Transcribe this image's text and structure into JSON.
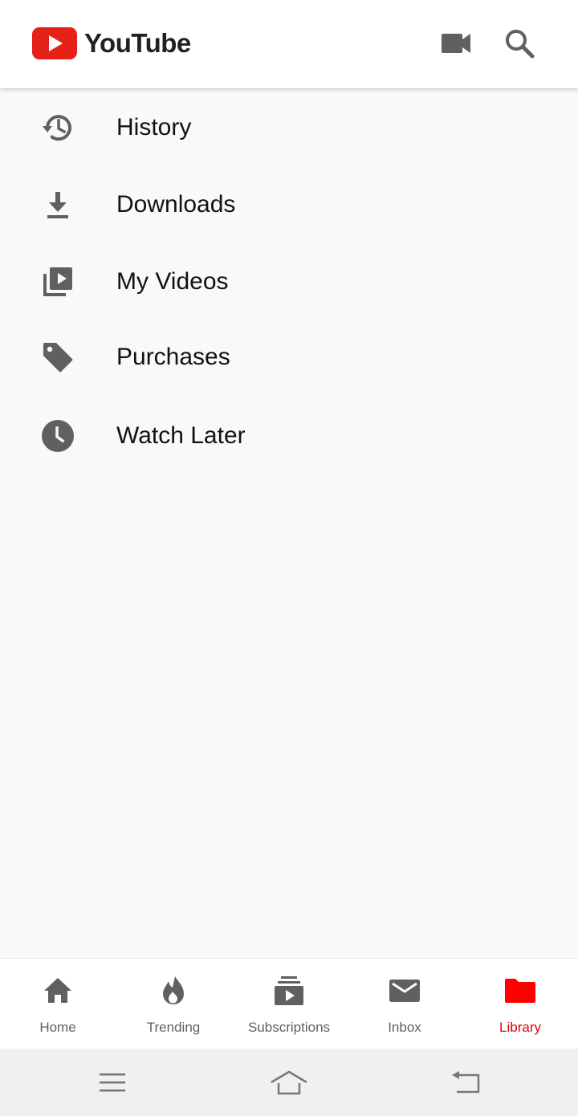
{
  "app": {
    "title": "YouTube",
    "accent_color": "#ff0000",
    "icon_color": "#606060"
  },
  "header": {
    "icons": [
      "video-camera-icon",
      "search-icon"
    ]
  },
  "library_menu": {
    "items": [
      {
        "label": "History",
        "icon": "history-icon"
      },
      {
        "label": "Downloads",
        "icon": "download-icon"
      },
      {
        "label": "My Videos",
        "icon": "my-videos-icon"
      },
      {
        "label": "Purchases",
        "icon": "tag-icon"
      },
      {
        "label": "Watch Later",
        "icon": "clock-icon"
      }
    ]
  },
  "bottom_nav": {
    "active": "Library",
    "items": [
      {
        "label": "Home",
        "icon": "home-icon"
      },
      {
        "label": "Trending",
        "icon": "flame-icon"
      },
      {
        "label": "Subscriptions",
        "icon": "subscriptions-icon"
      },
      {
        "label": "Inbox",
        "icon": "mail-icon"
      },
      {
        "label": "Library",
        "icon": "folder-icon"
      }
    ]
  },
  "system_nav": {
    "icons": [
      "menu-lines-icon",
      "home-outline-icon",
      "back-icon"
    ]
  }
}
